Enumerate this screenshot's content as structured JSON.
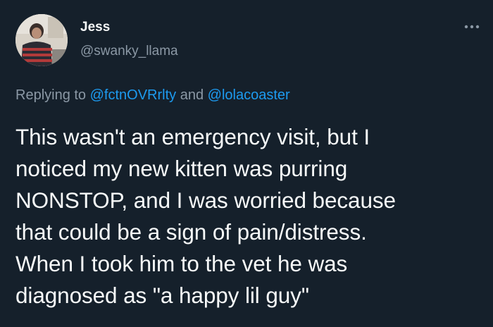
{
  "tweet": {
    "author": {
      "display_name": "Jess",
      "handle": "@swanky_llama",
      "avatar_icon": "profile-photo"
    },
    "more_icon": "more-horizontal-icon",
    "reply": {
      "prefix": "Replying to ",
      "mention_1": "@fctnOVRrlty",
      "joiner": " and ",
      "mention_2": "@lolacoaster"
    },
    "text_lines": [
      "This wasn't an emergency visit, but I",
      "noticed my new kitten was purring",
      "NONSTOP, and I was worried because",
      "that could be a sign of pain/distress.",
      "When I took him to the vet he was",
      "diagnosed as \"a happy lil guy\""
    ]
  },
  "colors": {
    "background": "#15202b",
    "primary_text": "#f7f9f9",
    "secondary_text": "#8b98a5",
    "link": "#1d9bf0"
  }
}
